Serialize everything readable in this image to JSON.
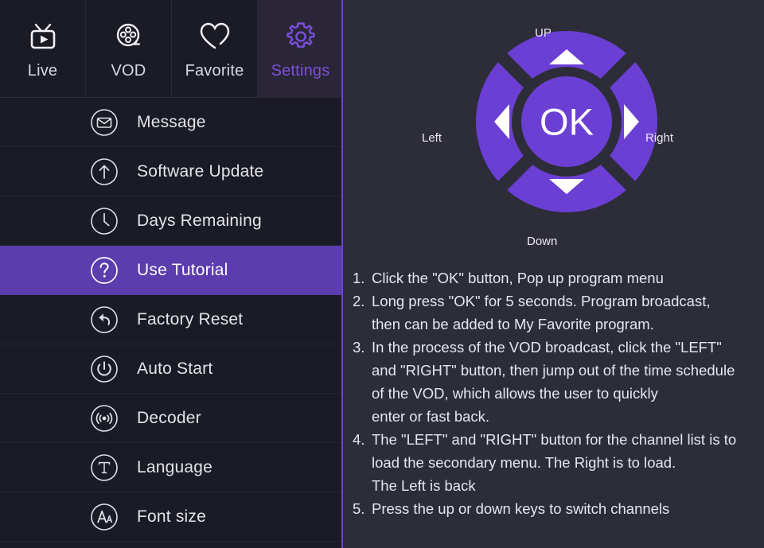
{
  "colors": {
    "bg_left": "#1b1b26",
    "bg_right": "#2d2d3a",
    "accent": "#6f46c8",
    "accent_bright": "#6B3FD4",
    "selected_row": "#5b3dad",
    "tab_active_text": "#7a4fdd",
    "text": "#e6e6ee"
  },
  "tabs": [
    {
      "label": "Live",
      "icon": "tv-play-icon",
      "active": false
    },
    {
      "label": "VOD",
      "icon": "film-reel-icon",
      "active": false
    },
    {
      "label": "Favorite",
      "icon": "heart-icon",
      "active": false
    },
    {
      "label": "Settings",
      "icon": "gear-icon",
      "active": true
    }
  ],
  "menu": {
    "items": [
      {
        "label": "Message",
        "icon": "envelope-icon",
        "selected": false
      },
      {
        "label": "Software Update",
        "icon": "arrow-up-icon",
        "selected": false
      },
      {
        "label": "Days Remaining",
        "icon": "clock-icon",
        "selected": false
      },
      {
        "label": "Use Tutorial",
        "icon": "question-icon",
        "selected": true
      },
      {
        "label": "Factory Reset",
        "icon": "undo-arrow-icon",
        "selected": false
      },
      {
        "label": "Auto Start",
        "icon": "power-icon",
        "selected": false
      },
      {
        "label": "Decoder",
        "icon": "broadcast-icon",
        "selected": false
      },
      {
        "label": "Language",
        "icon": "letter-t-icon",
        "selected": false
      },
      {
        "label": "Font size",
        "icon": "font-size-icon",
        "selected": false
      }
    ]
  },
  "dpad": {
    "center_label": "OK",
    "up_label": "UP",
    "down_label": "Down",
    "left_label": "Left",
    "right_label": "Right"
  },
  "instructions": [
    {
      "num": "1.",
      "lines": [
        "Click the \"OK\" button, Pop up program menu"
      ]
    },
    {
      "num": "2.",
      "lines": [
        "Long press \"OK\" for 5 seconds. Program broadcast,",
        "then can be added to My Favorite program."
      ]
    },
    {
      "num": "3.",
      "lines": [
        "In the process of the VOD broadcast, click the \"LEFT\"",
        "and \"RIGHT\" button, then jump out of the time schedule",
        "of the VOD, which allows the user to quickly",
        " enter or fast back."
      ]
    },
    {
      "num": "4.",
      "lines": [
        "The \"LEFT\" and \"RIGHT\" button for the channel list is to",
        "load the secondary menu. The Right is to load.",
        "The Left is back"
      ]
    },
    {
      "num": "5.",
      "lines": [
        "Press the up or down keys to switch channels"
      ]
    }
  ]
}
